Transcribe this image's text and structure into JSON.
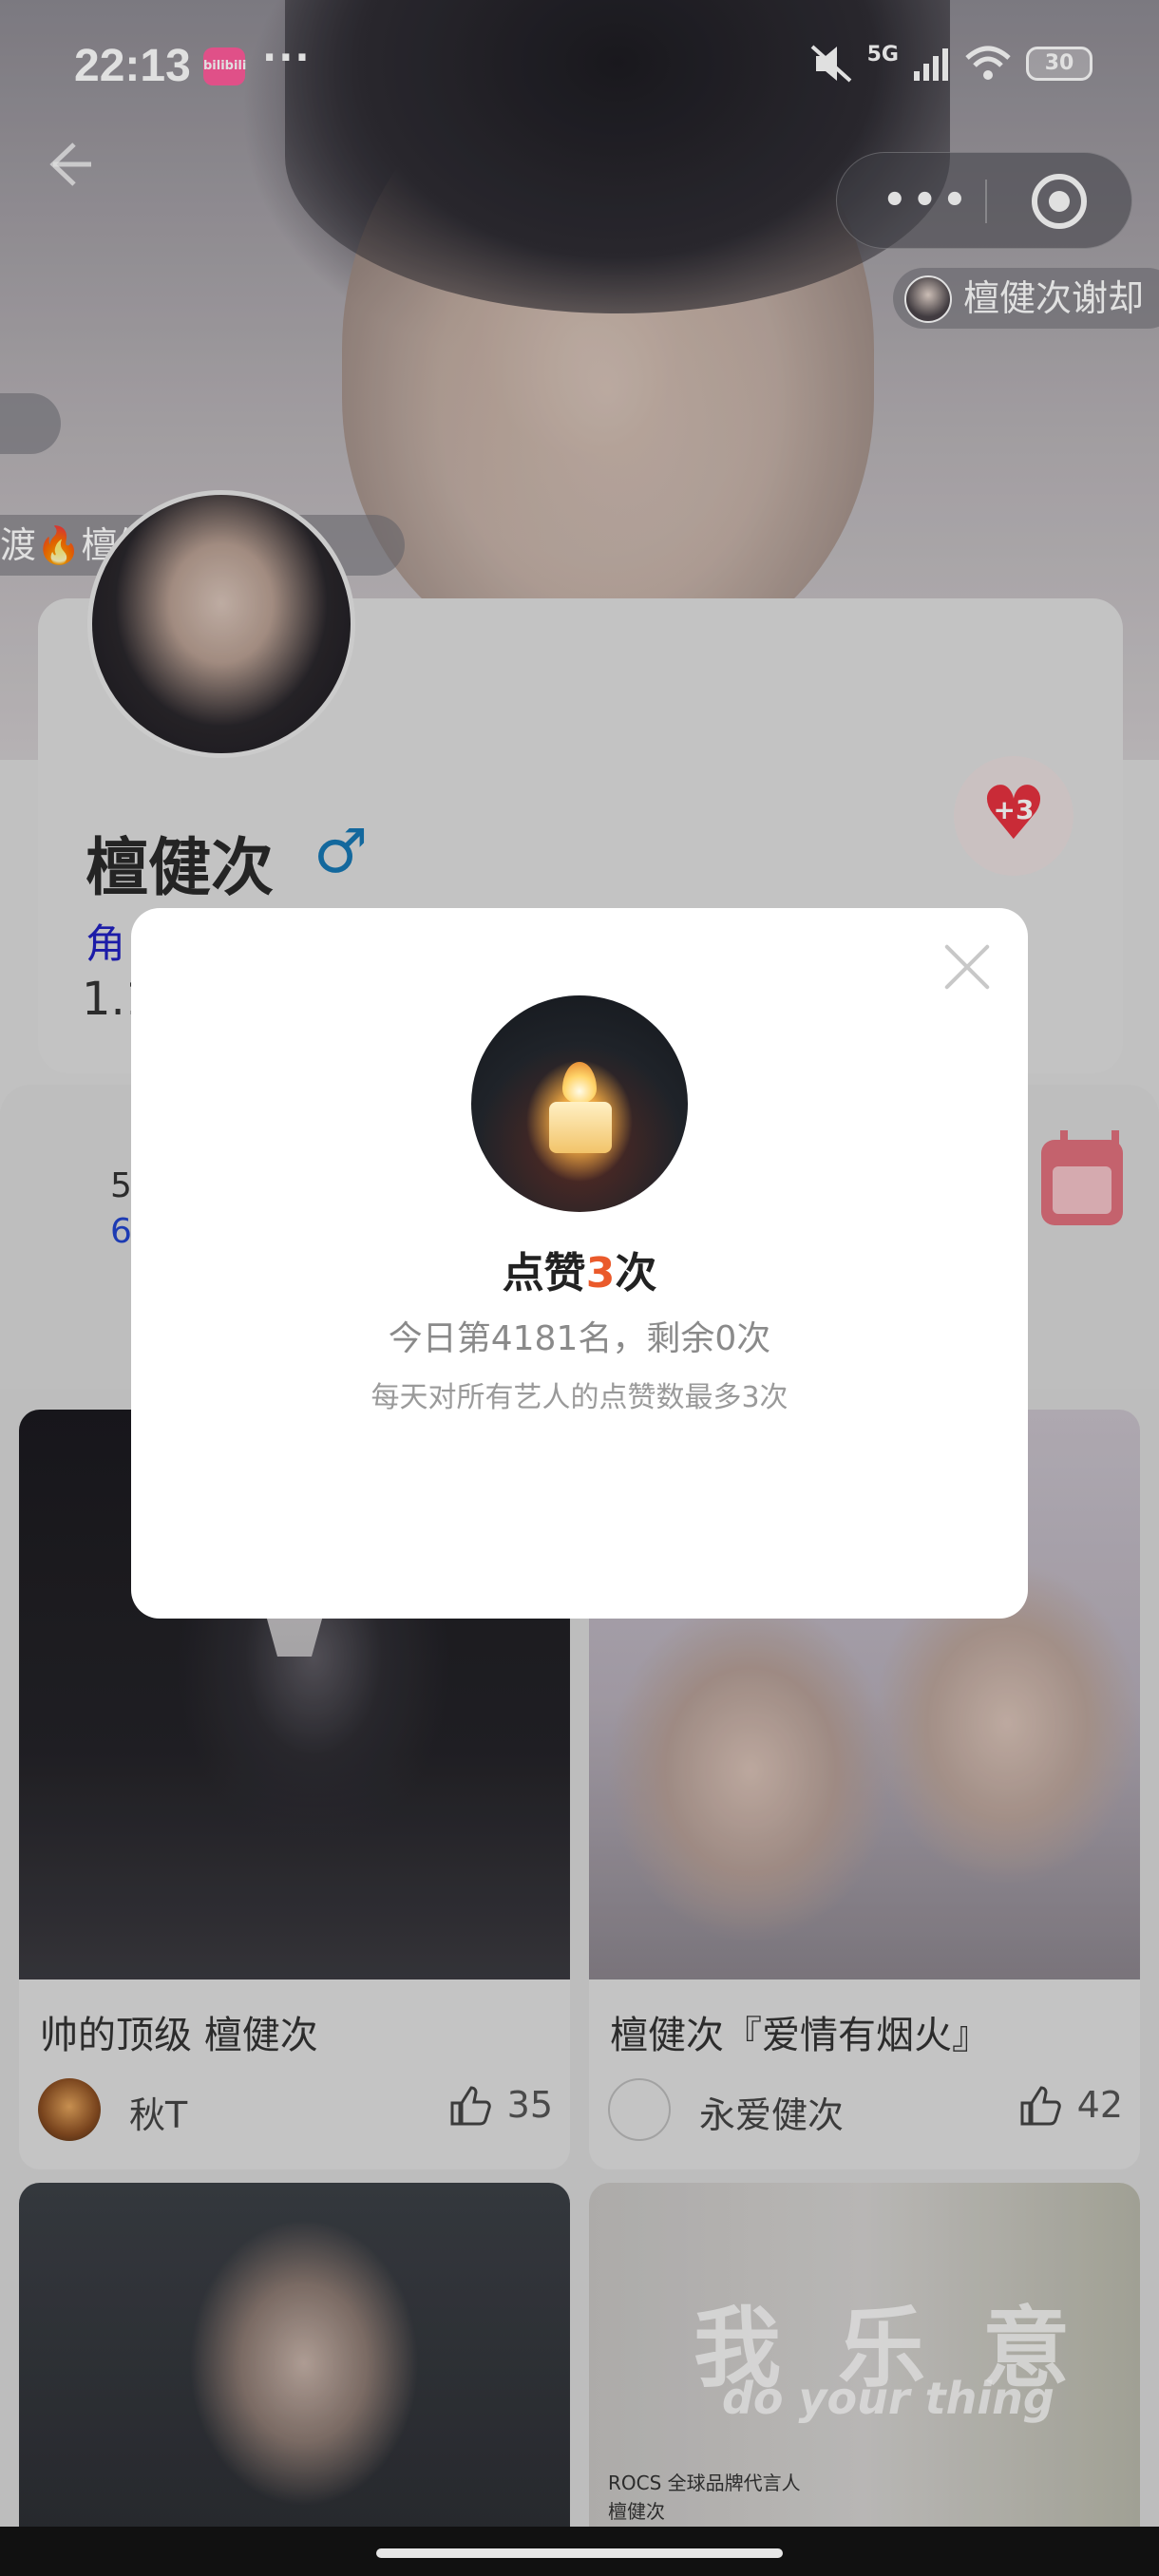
{
  "status_bar": {
    "time": "22:13",
    "app_badge": "bilibili",
    "dots": "···",
    "network": "5G",
    "battery": "30"
  },
  "capsule": {
    "more": "•••"
  },
  "danmaku": [
    {
      "text": "檀健次谢却"
    },
    {
      "text": "🔥"
    },
    {
      "text": "渡🔥檀健次🔥"
    }
  ],
  "profile": {
    "name": "檀健次",
    "gender_symbol": "♂",
    "role": "角",
    "fans": "1.1",
    "like_badge": "+3"
  },
  "stats": {
    "value1": "5",
    "value2": "6"
  },
  "modal": {
    "headline_prefix": "点赞",
    "headline_count": "3",
    "headline_suffix": "次",
    "rank_text": "今日第4181名，剩余0次",
    "note": "每天对所有艺人的点赞数最多3次"
  },
  "posts": [
    {
      "title": "帅的顶级 檀健次",
      "author": "秋T",
      "likes": "35"
    },
    {
      "title": "檀健次『爱情有烟火』",
      "author": "永爱健次",
      "likes": "42"
    }
  ],
  "post4_overlay": {
    "big": "我乐意",
    "sub": "do your thing",
    "small": "ROCS 全球品牌代言人",
    "small2": "檀健次"
  },
  "colors": {
    "accent_orange": "#ea5a2b",
    "heart_red": "#e5323f",
    "gender_blue": "#1677b3"
  }
}
